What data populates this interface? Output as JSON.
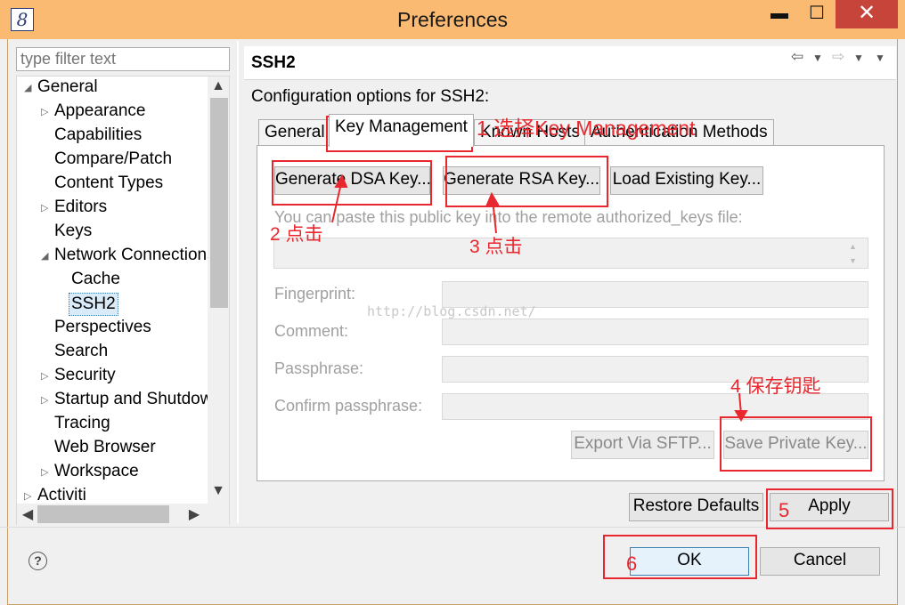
{
  "window": {
    "title": "Preferences",
    "app_icon": "8",
    "min": "▬",
    "max": "☐",
    "close": "✕"
  },
  "sidebar": {
    "filter_placeholder": "type filter text",
    "items": [
      {
        "label": "General",
        "arrow": "◢"
      },
      {
        "label": "Appearance",
        "arrow": "▷"
      },
      {
        "label": "Capabilities",
        "arrow": ""
      },
      {
        "label": "Compare/Patch",
        "arrow": ""
      },
      {
        "label": "Content Types",
        "arrow": ""
      },
      {
        "label": "Editors",
        "arrow": "▷"
      },
      {
        "label": "Keys",
        "arrow": ""
      },
      {
        "label": "Network Connections",
        "arrow": "◢"
      },
      {
        "label": "Cache",
        "arrow": ""
      },
      {
        "label": "SSH2",
        "arrow": ""
      },
      {
        "label": "Perspectives",
        "arrow": ""
      },
      {
        "label": "Search",
        "arrow": ""
      },
      {
        "label": "Security",
        "arrow": "▷"
      },
      {
        "label": "Startup and Shutdown",
        "arrow": "▷"
      },
      {
        "label": "Tracing",
        "arrow": ""
      },
      {
        "label": "Web Browser",
        "arrow": ""
      },
      {
        "label": "Workspace",
        "arrow": "▷"
      },
      {
        "label": "Activiti",
        "arrow": "▷"
      }
    ],
    "scroll_up": "▲",
    "scroll_down": "▼",
    "scroll_left": "◀",
    "scroll_right": "▶"
  },
  "page": {
    "title": "SSH2",
    "nav_back": "⇦",
    "nav_forward": "⇨",
    "nav_menu": "▼",
    "description": "Configuration options for SSH2:",
    "tabs": [
      "General",
      "Key Management",
      "Known Hosts",
      "Authentication Methods"
    ],
    "buttons": {
      "gen_dsa": "Generate DSA Key...",
      "gen_rsa": "Generate RSA Key...",
      "load_key": "Load Existing Key..."
    },
    "paste_hint": "You can paste this public key into the remote authorized_keys file:",
    "fields": {
      "fingerprint": "Fingerprint:",
      "comment": "Comment:",
      "passphrase": "Passphrase:",
      "confirm": "Confirm passphrase:"
    },
    "export_sftp": "Export Via SFTP...",
    "save_private": "Save Private Key..."
  },
  "footer": {
    "restore_defaults": "Restore Defaults",
    "apply": "Apply",
    "ok": "OK",
    "cancel": "Cancel",
    "help_icon": "?"
  },
  "annotations": {
    "a1": "1 选择Key Management",
    "a2": "2 点击",
    "a3": "3 点击",
    "a4": "4 保存钥匙",
    "a5": "5",
    "a6": "6",
    "watermark": "http://blog.csdn.net/"
  },
  "colors": {
    "titlebar": "#fbba71",
    "close": "#c7443a",
    "annotation": "#e8282e"
  }
}
